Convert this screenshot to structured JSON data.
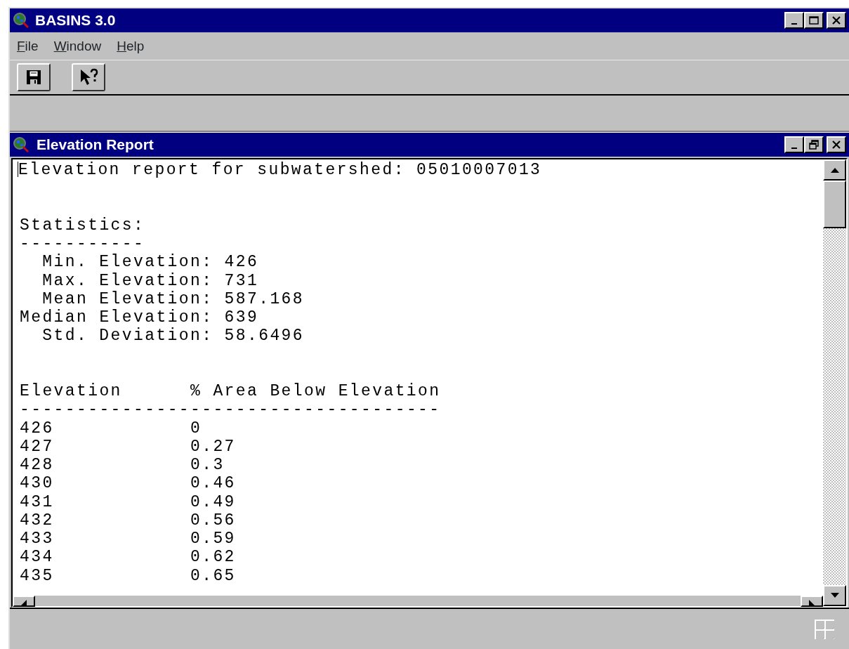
{
  "window": {
    "title": "BASINS 3.0"
  },
  "menu": [
    {
      "label": "File"
    },
    {
      "label": "Window"
    },
    {
      "label": "Help"
    }
  ],
  "toolbar": [
    {
      "kind": "save"
    },
    {
      "kind": "help-pointer"
    }
  ],
  "child_window": {
    "title": "Elevation Report",
    "maximized": true
  },
  "report": {
    "heading": "Elevation report for subwatershed: 05010007013",
    "statistics_title": "Statistics:",
    "statistics_rule": "-----------",
    "statistics": [
      {
        "label": "Min. Elevation:",
        "value": "426"
      },
      {
        "label": "Max. Elevation:",
        "value": "731"
      },
      {
        "label": "Mean Elevation:",
        "value": "587.168"
      },
      {
        "label": "Median Elevation:",
        "value": "639"
      },
      {
        "label": "Std. Deviation:",
        "value": "58.6496"
      }
    ],
    "columns": [
      "Elevation",
      "% Area Below Elevation"
    ],
    "table_rule": "-------------------------------------",
    "rows": [
      [
        "426",
        "0"
      ],
      [
        "427",
        "0.27"
      ],
      [
        "428",
        "0.3"
      ],
      [
        "430",
        "0.46"
      ],
      [
        "431",
        "0.49"
      ],
      [
        "432",
        "0.56"
      ],
      [
        "433",
        "0.59"
      ],
      [
        "434",
        "0.62"
      ],
      [
        "435",
        "0.65"
      ]
    ]
  }
}
